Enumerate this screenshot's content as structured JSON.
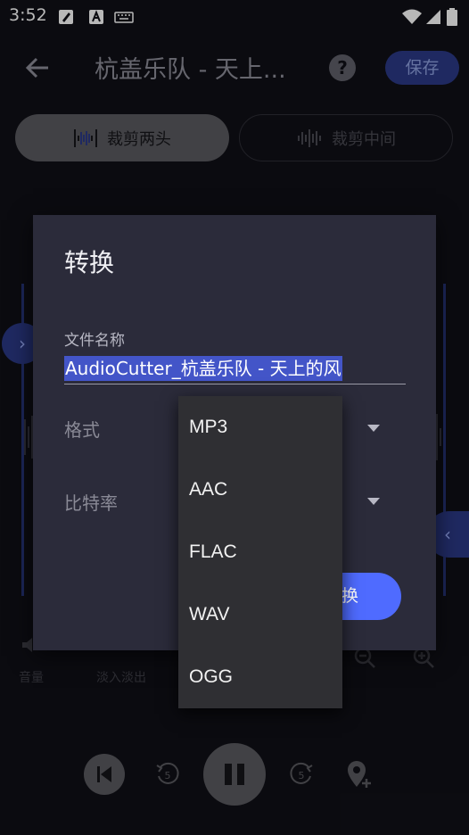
{
  "status_bar": {
    "time": "3:52"
  },
  "app_bar": {
    "title": "杭盖乐队 - 天上...",
    "help_icon": "?",
    "save_label": "保存"
  },
  "mode_toggle": {
    "trim_ends_label": "裁剪两头",
    "trim_middle_label": "裁剪中间"
  },
  "toolbar": {
    "volume_label": "音量",
    "fade_label": "淡入淡出"
  },
  "dialog": {
    "title": "转换",
    "filename_label": "文件名称",
    "filename_value": "AudioCutter_杭盖乐队 - 天上的风",
    "format_label": "格式",
    "bitrate_label": "比特率",
    "convert_label": "换"
  },
  "format_menu": {
    "options": [
      "MP3",
      "AAC",
      "FLAC",
      "WAV",
      "OGG"
    ]
  },
  "colors": {
    "accent": "#4f6bff",
    "save_bg": "#2b3a87",
    "dialog_bg": "#2b2b3a",
    "menu_bg": "#2f2f33"
  }
}
